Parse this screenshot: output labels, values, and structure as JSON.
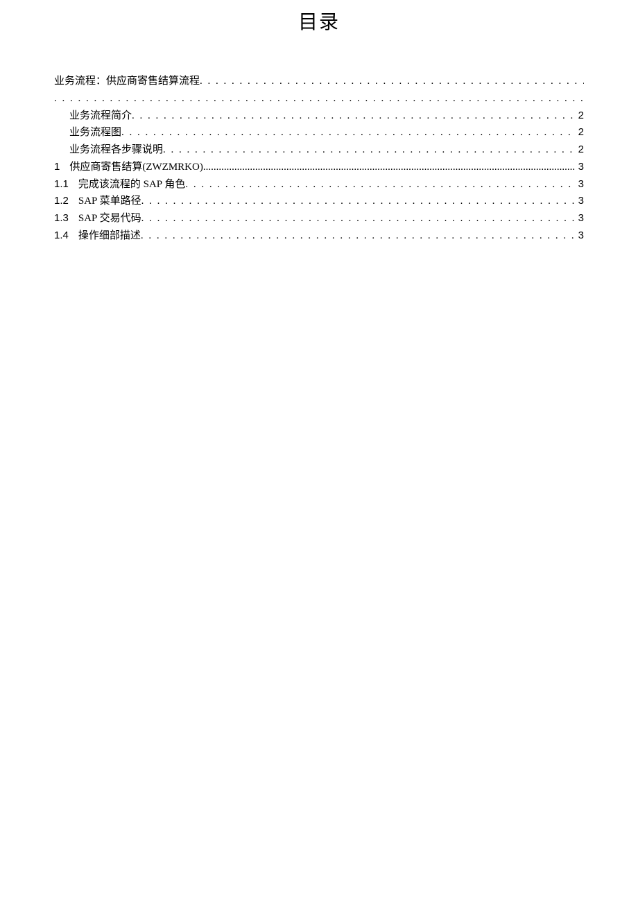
{
  "title": "目录",
  "toc": {
    "main": {
      "label": "业务流程：供应商寄售结算流程",
      "page": ""
    },
    "items": [
      {
        "num": "",
        "label": "业务流程简介",
        "page": "2",
        "indent": 1,
        "tight": false
      },
      {
        "num": "",
        "label": "业务流程图",
        "page": "2",
        "indent": 1,
        "tight": false
      },
      {
        "num": "",
        "label": "业务流程各步骤说明",
        "page": "2",
        "indent": 1,
        "tight": false
      },
      {
        "num": "1",
        "label": "供应商寄售结算(ZWZMRKO)",
        "page": "3",
        "indent": 0,
        "tight": true
      },
      {
        "num": "1.1",
        "label": "完成该流程的 SAP 角色",
        "page": "3",
        "indent": 0,
        "tight": false
      },
      {
        "num": "1.2",
        "label": "SAP 菜单路径",
        "page": "3",
        "indent": 0,
        "tight": false
      },
      {
        "num": "1.3",
        "label": "SAP 交易代码",
        "page": "3",
        "indent": 0,
        "tight": false
      },
      {
        "num": "1.4",
        "label": "操作细部描述",
        "page": "3",
        "indent": 0,
        "tight": false
      }
    ]
  }
}
